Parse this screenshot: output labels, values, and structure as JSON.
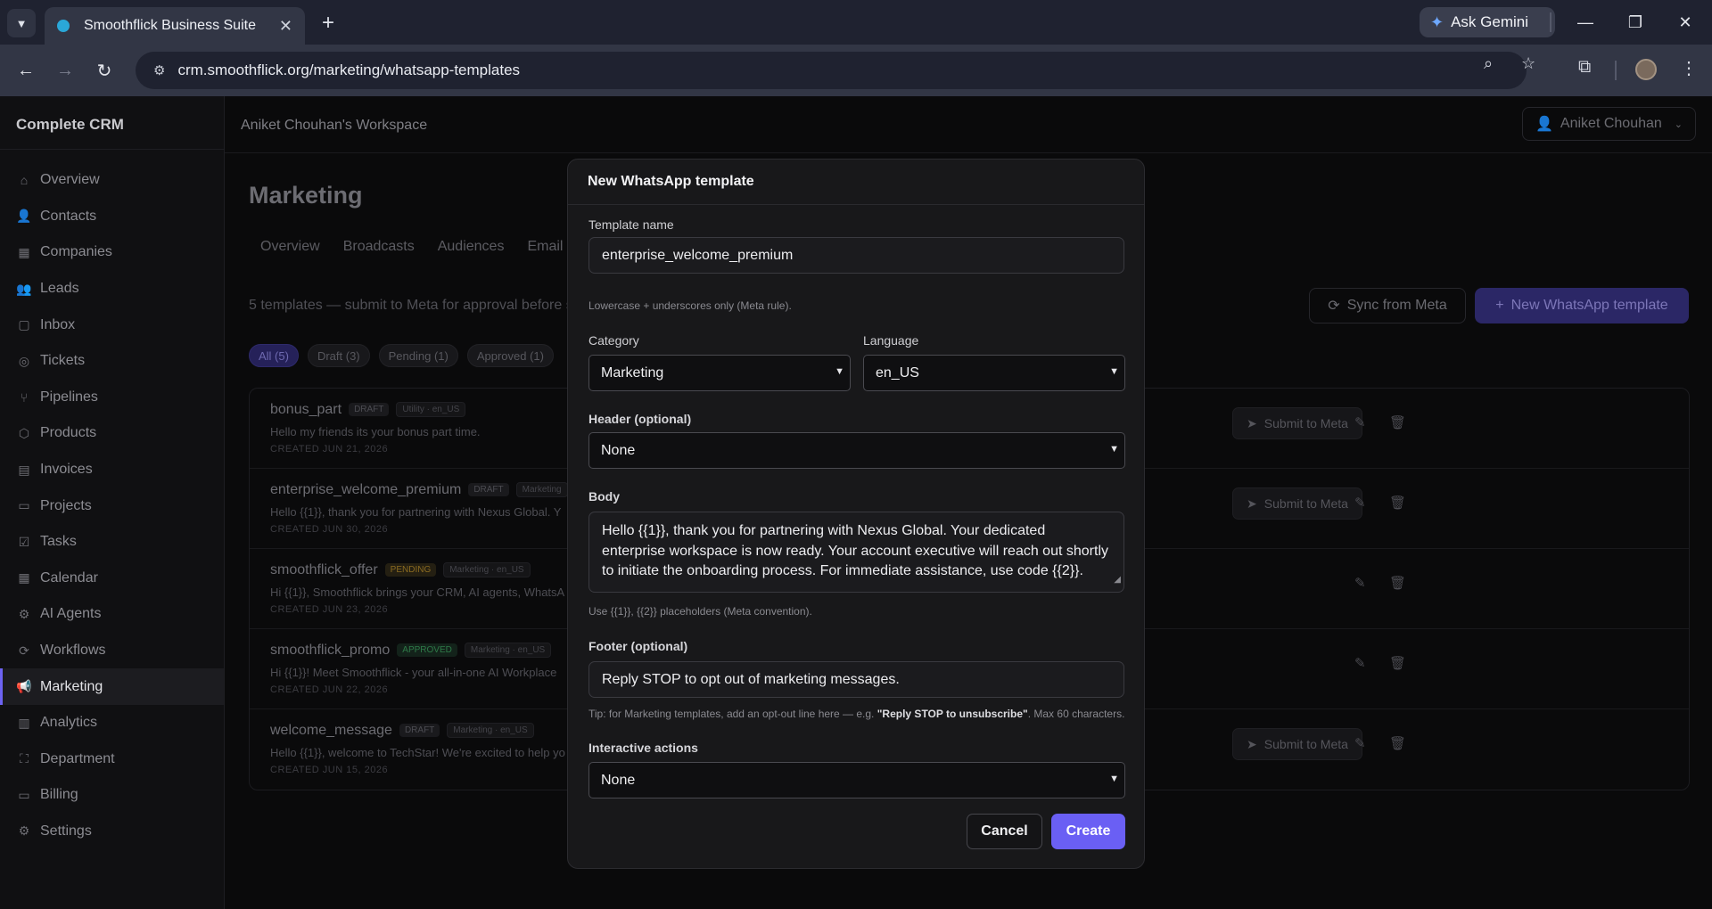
{
  "browser": {
    "tab_title": "Smoothflick Business Suite",
    "ask_gemini": "Ask Gemini",
    "url": "crm.smoothflick.org/marketing/whatsapp-templates"
  },
  "app": {
    "brand": "Complete CRM",
    "workspace": "Aniket Chouhan's Workspace",
    "user": "Aniket Chouhan"
  },
  "sidebar": {
    "items": [
      {
        "label": "Overview",
        "icon": "⌂"
      },
      {
        "label": "Contacts",
        "icon": "👤"
      },
      {
        "label": "Companies",
        "icon": "▦"
      },
      {
        "label": "Leads",
        "icon": "👥"
      },
      {
        "label": "Inbox",
        "icon": "▢"
      },
      {
        "label": "Tickets",
        "icon": "◎"
      },
      {
        "label": "Pipelines",
        "icon": "⑂"
      },
      {
        "label": "Products",
        "icon": "⬡"
      },
      {
        "label": "Invoices",
        "icon": "▤"
      },
      {
        "label": "Projects",
        "icon": "▭"
      },
      {
        "label": "Tasks",
        "icon": "☑"
      },
      {
        "label": "Calendar",
        "icon": "▦"
      },
      {
        "label": "AI Agents",
        "icon": "⚙"
      },
      {
        "label": "Workflows",
        "icon": "⟳"
      },
      {
        "label": "Marketing",
        "icon": "📢"
      },
      {
        "label": "Analytics",
        "icon": "▥"
      },
      {
        "label": "Department",
        "icon": "⛶"
      },
      {
        "label": "Billing",
        "icon": "▭"
      },
      {
        "label": "Settings",
        "icon": "⚙"
      }
    ],
    "active": "Marketing"
  },
  "page": {
    "title": "Marketing",
    "tabs": [
      "Overview",
      "Broadcasts",
      "Audiences",
      "Email"
    ],
    "subtext": "5 templates — submit to Meta for approval before s",
    "sync_label": "Sync from Meta",
    "new_label": "New WhatsApp template",
    "filters": [
      "All (5)",
      "Draft (3)",
      "Pending (1)",
      "Approved (1)"
    ]
  },
  "templates": [
    {
      "name": "bonus_part",
      "status": "DRAFT",
      "meta": "Utility · en_US",
      "body": "Hello my friends its your bonus part time.",
      "created": "CREATED JUN 21, 2026",
      "submit": "Submit to Meta"
    },
    {
      "name": "enterprise_welcome_premium",
      "status": "DRAFT",
      "meta": "Marketing",
      "body": "Hello {{1}}, thank you for partnering with Nexus Global. Y",
      "created": "CREATED JUN 30, 2026",
      "submit": "Submit to Meta"
    },
    {
      "name": "smoothflick_offer",
      "status": "PENDING",
      "meta": "Marketing · en_US",
      "body": "Hi {{1}}, Smoothflick brings your CRM, AI agents, WhatsA",
      "created": "CREATED JUN 23, 2026",
      "submit": ""
    },
    {
      "name": "smoothflick_promo",
      "status": "APPROVED",
      "meta": "Marketing · en_US",
      "body": "Hi {{1}}! Meet Smoothflick - your all-in-one AI Workplace",
      "created": "CREATED JUN 22, 2026",
      "submit": ""
    },
    {
      "name": "welcome_message",
      "status": "DRAFT",
      "meta": "Marketing · en_US",
      "body": "Hello {{1}}, welcome to TechStar! We're excited to help yo",
      "created": "CREATED JUN 15, 2026",
      "submit": "Submit to Meta"
    }
  ],
  "modal": {
    "title": "New WhatsApp template",
    "template_name_label": "Template name",
    "template_name_value": "enterprise_welcome_premium",
    "template_name_hint": "Lowercase + underscores only (Meta rule).",
    "category_label": "Category",
    "category_value": "Marketing",
    "language_label": "Language",
    "language_value": "en_US",
    "header_label": "Header (optional)",
    "header_value": "None",
    "body_label": "Body",
    "body_value": "Hello {{1}}, thank you for partnering with Nexus Global. Your dedicated enterprise workspace is now ready. Your account executive will reach out shortly to initiate the onboarding process. For immediate assistance, use code {{2}}.",
    "body_hint": "Use {{1}}, {{2}} placeholders (Meta convention).",
    "footer_label": "Footer (optional)",
    "footer_value": "Reply STOP to opt out of marketing messages.",
    "footer_hint_pre": "Tip: for Marketing templates, add an opt-out line here — e.g. ",
    "footer_hint_bold": "\"Reply STOP to unsubscribe\"",
    "footer_hint_post": ". Max 60 characters.",
    "actions_label": "Interactive actions",
    "actions_value": "None",
    "cancel_label": "Cancel",
    "create_label": "Create"
  }
}
